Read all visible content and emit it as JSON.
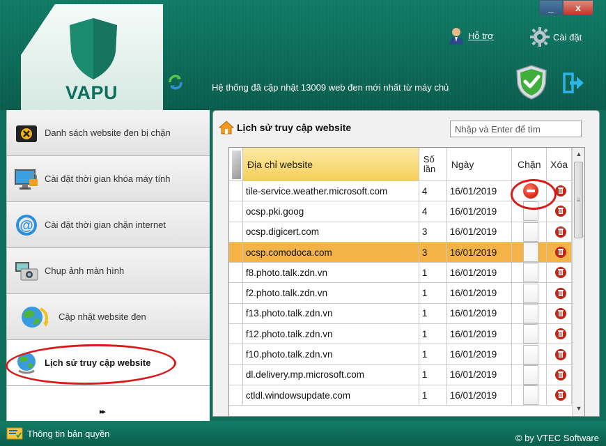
{
  "app": {
    "logo_text": "VAPU"
  },
  "window": {
    "minimize_label": "_",
    "close_label": "x"
  },
  "header": {
    "support_label": "Hỗ trợ",
    "settings_label": "Cài đặt",
    "status_message": "Hệ thống đã cập nhật 13009 web đen mới nhất từ máy chủ"
  },
  "sidebar": {
    "items": [
      {
        "label": "Danh sách website đen bị chặn",
        "icon": "blocked-list-icon"
      },
      {
        "label": "Cài đặt thời gian khóa máy tính",
        "icon": "computer-lock-icon"
      },
      {
        "label": "Cài đặt thời gian chặn internet",
        "icon": "internet-at-icon"
      },
      {
        "label": "Chụp ảnh màn hình",
        "icon": "camera-icon"
      },
      {
        "label": "Cập nhật website đen",
        "icon": "globe-update-icon"
      },
      {
        "label": "Lịch sử truy cập website",
        "icon": "globe-history-icon"
      }
    ],
    "more_label": "▸▸"
  },
  "main": {
    "title": "Lịch sử truy cập website",
    "search_placeholder": "Nhập và Enter để tìm",
    "columns": {
      "address": "Địa chỉ website",
      "times": "Số lần",
      "date": "Ngày",
      "block": "Chặn",
      "delete": "Xóa"
    },
    "rows": [
      {
        "address": "tile-service.weather.microsoft.com",
        "times": "4",
        "date": "16/01/2019",
        "blocked": true
      },
      {
        "address": "ocsp.pki.goog",
        "times": "4",
        "date": "16/01/2019",
        "blocked": false
      },
      {
        "address": "ocsp.digicert.com",
        "times": "3",
        "date": "16/01/2019",
        "blocked": false
      },
      {
        "address": "ocsp.comodoca.com",
        "times": "3",
        "date": "16/01/2019",
        "blocked": false,
        "selected": true
      },
      {
        "address": "f8.photo.talk.zdn.vn",
        "times": "1",
        "date": "16/01/2019",
        "blocked": false
      },
      {
        "address": "f2.photo.talk.zdn.vn",
        "times": "1",
        "date": "16/01/2019",
        "blocked": false
      },
      {
        "address": "f13.photo.talk.zdn.vn",
        "times": "1",
        "date": "16/01/2019",
        "blocked": false
      },
      {
        "address": "f12.photo.talk.zdn.vn",
        "times": "1",
        "date": "16/01/2019",
        "blocked": false
      },
      {
        "address": "f10.photo.talk.zdn.vn",
        "times": "1",
        "date": "16/01/2019",
        "blocked": false
      },
      {
        "address": "dl.delivery.mp.microsoft.com",
        "times": "1",
        "date": "16/01/2019",
        "blocked": false
      },
      {
        "address": "ctldl.windowsupdate.com",
        "times": "1",
        "date": "16/01/2019",
        "blocked": false
      }
    ]
  },
  "footer": {
    "license_label": "Thông tin bản quyền",
    "copyright": "© by VTEC Software"
  },
  "colors": {
    "brand": "#0e6f5c",
    "selected_row": "#f3b347",
    "header_highlight": "#f4cf58",
    "annotation": "#d91b1b"
  }
}
